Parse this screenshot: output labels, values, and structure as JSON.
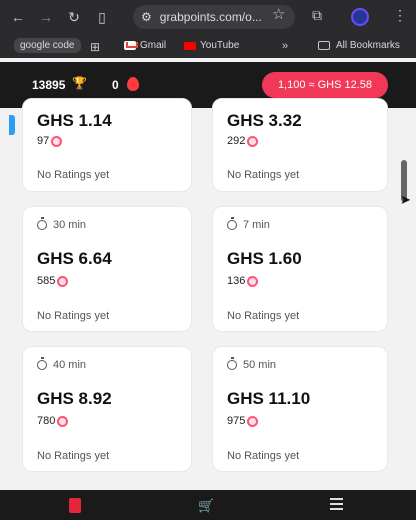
{
  "browser": {
    "url": "grabpoints.com/o...",
    "bookmarks": {
      "google_code": "google code",
      "gmail": "Gmail",
      "youtube": "YouTube",
      "all_bookmarks": "All Bookmarks"
    }
  },
  "header": {
    "points": "13895",
    "streak": "0",
    "rate": "1,100 ≈ GHS 12.58"
  },
  "offers": [
    {
      "time": "",
      "price": "GHS 1.14",
      "coins": "97",
      "rating": "No Ratings yet"
    },
    {
      "time": "",
      "price": "GHS 3.32",
      "coins": "292",
      "rating": "No Ratings yet"
    },
    {
      "time": "30 min",
      "price": "GHS 6.64",
      "coins": "585",
      "rating": "No Ratings yet"
    },
    {
      "time": "7 min",
      "price": "GHS 1.60",
      "coins": "136",
      "rating": "No Ratings yet"
    },
    {
      "time": "40 min",
      "price": "GHS 8.92",
      "coins": "780",
      "rating": "No Ratings yet"
    },
    {
      "time": "50 min",
      "price": "GHS 11.10",
      "coins": "975",
      "rating": "No Ratings yet"
    }
  ],
  "colors": {
    "accent": "#f23858",
    "appbar": "#1a1a1a",
    "card": "#ffffff",
    "page": "#f2f2f2"
  },
  "icons": {
    "back": "arrow-left-icon",
    "forward": "arrow-right-icon",
    "reload": "reload-icon",
    "sidebar": "sidebar-icon",
    "site-info": "tune-icon",
    "bookmark": "star-icon",
    "extensions": "puzzle-icon",
    "profile": "avatar-icon",
    "more": "kebab-menu-icon",
    "trophy": "trophy-icon",
    "streak": "flame-icon",
    "coin": "coin-icon",
    "timer": "timer-icon",
    "tasks": "clipboard-icon",
    "cart": "cart-icon",
    "menu": "hamburger-icon"
  }
}
